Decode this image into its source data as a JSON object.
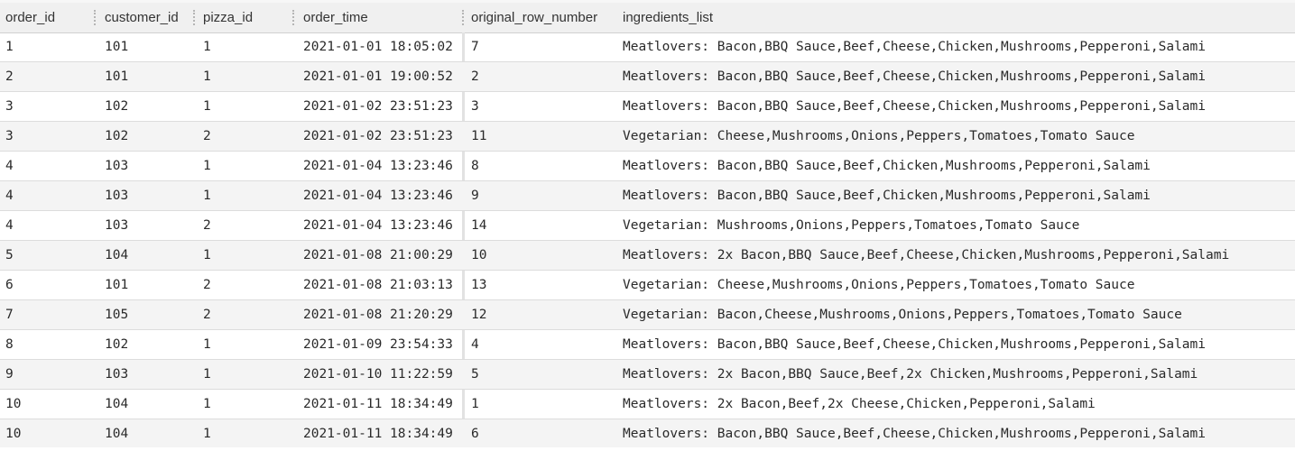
{
  "columns": [
    "order_id",
    "customer_id",
    "pizza_id",
    "order_time",
    "original_row_number",
    "ingredients_list"
  ],
  "rows": [
    [
      "1",
      "101",
      "1",
      "2021-01-01 18:05:02",
      "7",
      "Meatlovers: Bacon,BBQ Sauce,Beef,Cheese,Chicken,Mushrooms,Pepperoni,Salami"
    ],
    [
      "2",
      "101",
      "1",
      "2021-01-01 19:00:52",
      "2",
      "Meatlovers: Bacon,BBQ Sauce,Beef,Cheese,Chicken,Mushrooms,Pepperoni,Salami"
    ],
    [
      "3",
      "102",
      "1",
      "2021-01-02 23:51:23",
      "3",
      "Meatlovers: Bacon,BBQ Sauce,Beef,Cheese,Chicken,Mushrooms,Pepperoni,Salami"
    ],
    [
      "3",
      "102",
      "2",
      "2021-01-02 23:51:23",
      "11",
      "Vegetarian: Cheese,Mushrooms,Onions,Peppers,Tomatoes,Tomato Sauce"
    ],
    [
      "4",
      "103",
      "1",
      "2021-01-04 13:23:46",
      "8",
      "Meatlovers: Bacon,BBQ Sauce,Beef,Chicken,Mushrooms,Pepperoni,Salami"
    ],
    [
      "4",
      "103",
      "1",
      "2021-01-04 13:23:46",
      "9",
      "Meatlovers: Bacon,BBQ Sauce,Beef,Chicken,Mushrooms,Pepperoni,Salami"
    ],
    [
      "4",
      "103",
      "2",
      "2021-01-04 13:23:46",
      "14",
      "Vegetarian: Mushrooms,Onions,Peppers,Tomatoes,Tomato Sauce"
    ],
    [
      "5",
      "104",
      "1",
      "2021-01-08 21:00:29",
      "10",
      "Meatlovers: 2x Bacon,BBQ Sauce,Beef,Cheese,Chicken,Mushrooms,Pepperoni,Salami"
    ],
    [
      "6",
      "101",
      "2",
      "2021-01-08 21:03:13",
      "13",
      "Vegetarian: Cheese,Mushrooms,Onions,Peppers,Tomatoes,Tomato Sauce"
    ],
    [
      "7",
      "105",
      "2",
      "2021-01-08 21:20:29",
      "12",
      "Vegetarian: Bacon,Cheese,Mushrooms,Onions,Peppers,Tomatoes,Tomato Sauce"
    ],
    [
      "8",
      "102",
      "1",
      "2021-01-09 23:54:33",
      "4",
      "Meatlovers: Bacon,BBQ Sauce,Beef,Cheese,Chicken,Mushrooms,Pepperoni,Salami"
    ],
    [
      "9",
      "103",
      "1",
      "2021-01-10 11:22:59",
      "5",
      "Meatlovers: 2x Bacon,BBQ Sauce,Beef,2x Chicken,Mushrooms,Pepperoni,Salami"
    ],
    [
      "10",
      "104",
      "1",
      "2021-01-11 18:34:49",
      "1",
      "Meatlovers: 2x Bacon,Beef,2x Cheese,Chicken,Pepperoni,Salami"
    ],
    [
      "10",
      "104",
      "1",
      "2021-01-11 18:34:49",
      "6",
      "Meatlovers: Bacon,BBQ Sauce,Beef,Cheese,Chicken,Mushrooms,Pepperoni,Salami"
    ]
  ]
}
